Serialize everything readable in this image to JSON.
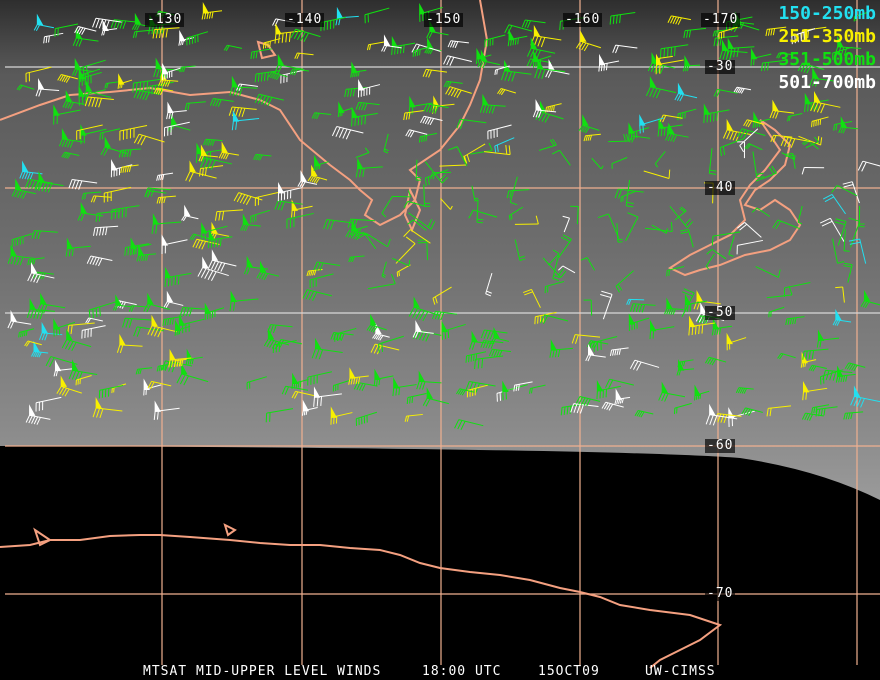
{
  "legend": [
    {
      "label": "150-250mb",
      "color": "#22e0f0"
    },
    {
      "label": "251-350mb",
      "color": "#f8f000"
    },
    {
      "label": "351-500mb",
      "color": "#10e010"
    },
    {
      "label": "501-700mb",
      "color": "#ffffff"
    }
  ],
  "longitude_labels": [
    "-130",
    "-140",
    "-150",
    "-160",
    "-170"
  ],
  "latitude_labels": [
    "-30",
    "-40",
    "-50",
    "-60",
    "-70"
  ],
  "footer": {
    "product": "MTSAT MID-UPPER LEVEL WINDS",
    "time": "18:00 UTC",
    "date": "15OCT09",
    "source": "UW-CIMSS"
  },
  "colors": {
    "grid": "#f0b090",
    "coast": "#f4a080"
  }
}
